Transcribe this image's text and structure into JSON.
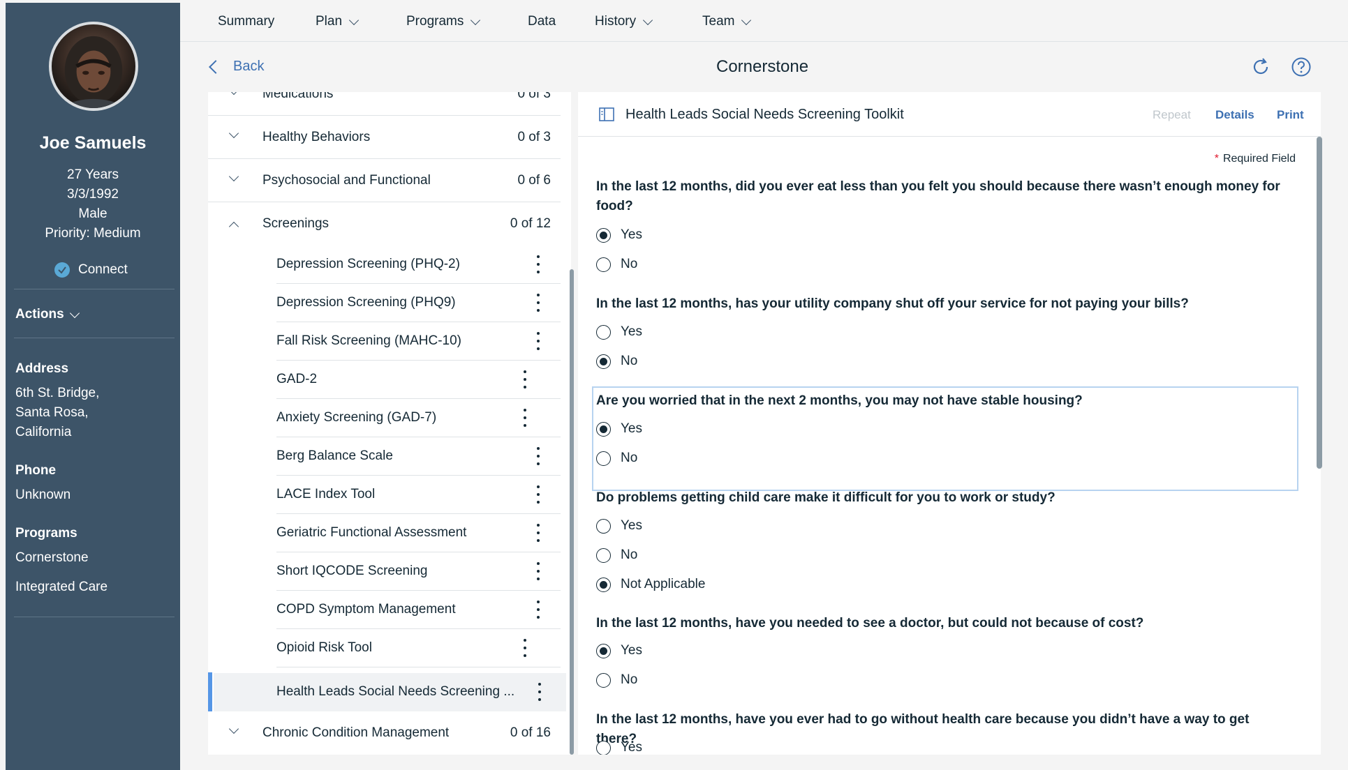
{
  "patient": {
    "name": "Joe Samuels",
    "age": "27 Years",
    "dob": "3/3/1992",
    "gender": "Male",
    "priority": "Priority: Medium",
    "connect_label": "Connect",
    "actions_label": "Actions",
    "address_label": "Address",
    "address_lines": [
      "6th St. Bridge,",
      "Santa Rosa,",
      "California"
    ],
    "phone_label": "Phone",
    "phone_value": "Unknown",
    "programs_label": "Programs",
    "programs": [
      "Cornerstone",
      "Integrated Care"
    ]
  },
  "topnav": [
    {
      "label": "Summary",
      "dropdown": false
    },
    {
      "label": "Plan",
      "dropdown": true
    },
    {
      "label": "Programs",
      "dropdown": true
    },
    {
      "label": "Data",
      "dropdown": false
    },
    {
      "label": "History",
      "dropdown": true
    },
    {
      "label": "Team",
      "dropdown": true
    }
  ],
  "header": {
    "back_label": "Back",
    "title": "Cornerstone",
    "icons": [
      "refresh-icon",
      "help-icon"
    ]
  },
  "list": {
    "categories_top": [
      {
        "label": "Medications",
        "count": "0 of 3"
      },
      {
        "label": "Healthy Behaviors",
        "count": "0 of 3"
      },
      {
        "label": "Psychosocial and Functional",
        "count": "0 of 6"
      },
      {
        "label": "Screenings",
        "count": "0 of 12"
      }
    ],
    "screenings": [
      "Depression Screening (PHQ-2)",
      "Depression Screening (PHQ9)",
      "Fall Risk Screening (MAHC-10)",
      "GAD-2",
      "Anxiety Screening (GAD-7)",
      "Berg Balance Scale",
      "LACE Index Tool",
      "Geriatric Functional Assessment",
      "Short IQCODE Screening",
      "COPD Symptom Management",
      "Opioid Risk Tool",
      "Health Leads Social Needs Screening ..."
    ],
    "category_bottom": {
      "label": "Chronic Condition Management",
      "count": "0 of 16"
    }
  },
  "form": {
    "title": "Health Leads Social Needs Screening Toolkit",
    "title_icon": "sidebar-panel-icon",
    "repeat_label": "Repeat",
    "details_label": "Details",
    "print_label": "Print",
    "required_label": "Required Field",
    "questions": [
      {
        "text": "In the last 12 months, did you ever eat less than you felt you should because there wasn’t enough money for food?",
        "options": [
          "Yes",
          "No"
        ],
        "selected": "Yes"
      },
      {
        "text": "In the last 12 months, has your utility company shut off your service for not paying your bills?",
        "options": [
          "Yes",
          "No"
        ],
        "selected": "No"
      },
      {
        "text": "Are you worried that in the next 2 months, you may not have stable housing?",
        "options": [
          "Yes",
          "No"
        ],
        "selected": "Yes"
      },
      {
        "text": "Do problems getting child care make it difficult for you to work or study?",
        "options": [
          "Yes",
          "No",
          "Not Applicable"
        ],
        "selected": "Not Applicable"
      },
      {
        "text": "In the last 12 months, have you needed to see a doctor, but could not because of cost?",
        "options": [
          "Yes",
          "No"
        ],
        "selected": "Yes"
      },
      {
        "text": "In the last 12 months, have you ever had to go without health care because you didn’t have a way to get there?",
        "options": [
          "Yes"
        ],
        "selected": ""
      }
    ]
  }
}
